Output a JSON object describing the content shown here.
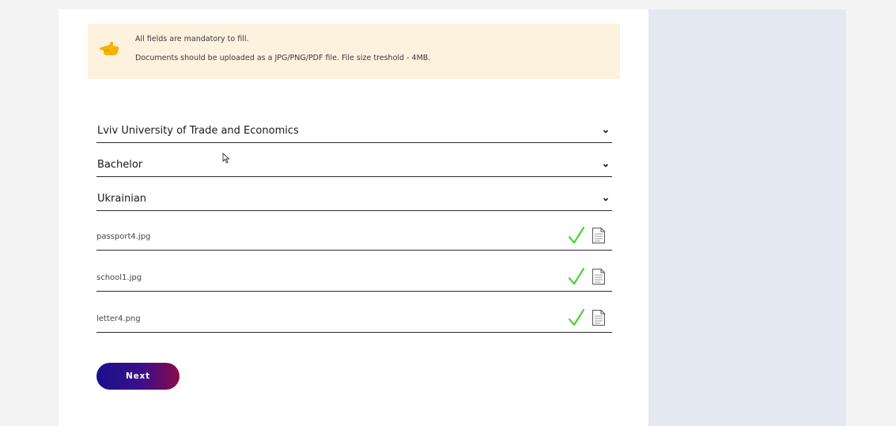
{
  "notice": {
    "line1": "All fields are mandatory to fill.",
    "line2": "Documents should be uploaded as a JPG/PNG/PDF file. File size treshold - 4MB.",
    "icon": "pointing-hand-icon"
  },
  "form": {
    "university": "Lviv University of Trade and Economics",
    "degree": "Bachelor",
    "language": "Ukrainian",
    "files": [
      {
        "name": "passport4.jpg",
        "status": "uploaded"
      },
      {
        "name": "school1.jpg",
        "status": "uploaded"
      },
      {
        "name": "letter4.png",
        "status": "uploaded"
      }
    ],
    "next_label": "Next"
  },
  "colors": {
    "notice_bg": "#fdf2dd",
    "check": "#4cd137",
    "side_panel": "#e4e9f1",
    "button_start": "#1a0f8c",
    "button_end": "#8a0a4a"
  }
}
